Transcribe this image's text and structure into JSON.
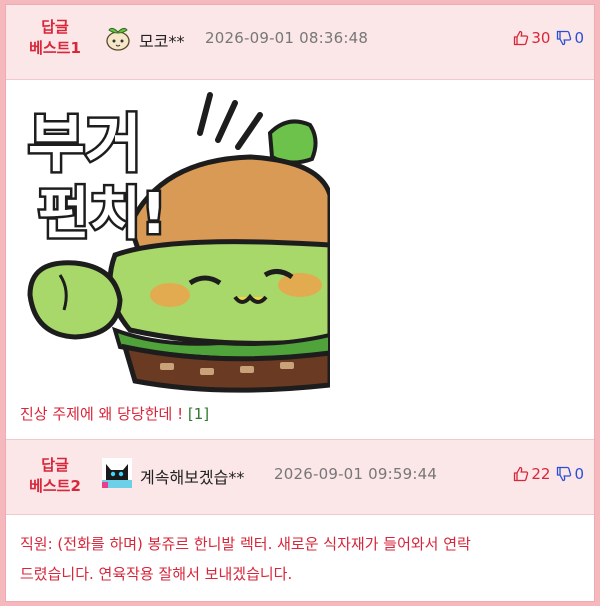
{
  "comments": [
    {
      "badge_line1": "답글",
      "badge_line2": "베스트1",
      "nickname": "모코**",
      "datetime": "2026-09-01 08:36:48",
      "upvotes": "30",
      "downvotes": "0",
      "sticker_text_line1": "부거",
      "sticker_text_line2": "펀치!",
      "text": "진상 주제에 왜 당당한데 ! ",
      "link": "[1]"
    },
    {
      "badge_line1": "답글",
      "badge_line2": "베스트2",
      "nickname": "계속해보겠습**",
      "datetime": "2026-09-01 09:59:44",
      "upvotes": "22",
      "downvotes": "0",
      "text_line1": "직원: (전화를 하며) 봉쥬르 한니발 렉터. 새로운 식자재가 들어와서 연락",
      "text_line2": "드렸습니다. 연육작용 잘해서 보내겠습니다."
    }
  ],
  "colors": {
    "accent_red": "#d8263a",
    "down_blue": "#2a4fd6",
    "header_bg": "#fbe6e8",
    "frame_border": "#f4b8bd"
  }
}
